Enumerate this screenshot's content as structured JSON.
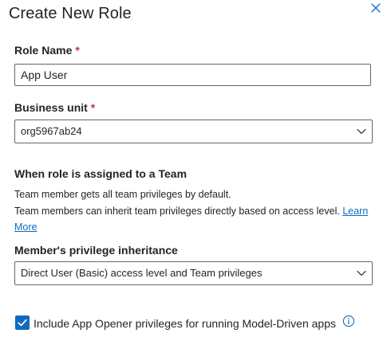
{
  "dialog": {
    "title": "Create New Role"
  },
  "role_name": {
    "label": "Role Name",
    "required_mark": "*",
    "value": "App User"
  },
  "business_unit": {
    "label": "Business unit",
    "required_mark": "*",
    "selected": "org5967ab24"
  },
  "team_section": {
    "title": "When role is assigned to a Team",
    "line1": "Team member gets all team privileges by default.",
    "line2_text": "Team members can inherit team privileges directly based on access level.",
    "learn_more_part1": "Learn",
    "learn_more_part2": "More"
  },
  "inheritance": {
    "label": "Member's privilege inheritance",
    "selected": "Direct User (Basic) access level and Team privileges"
  },
  "app_opener": {
    "checked": true,
    "label": "Include App Opener privileges for running Model-Driven apps"
  },
  "icons": {
    "close": "close-icon",
    "chevron": "chevron-down-icon",
    "checkmark": "checkmark-icon",
    "info": "info-icon"
  },
  "colors": {
    "accent": "#0f6cbd",
    "required": "#c4314b",
    "border": "#666666",
    "text": "#242424"
  }
}
